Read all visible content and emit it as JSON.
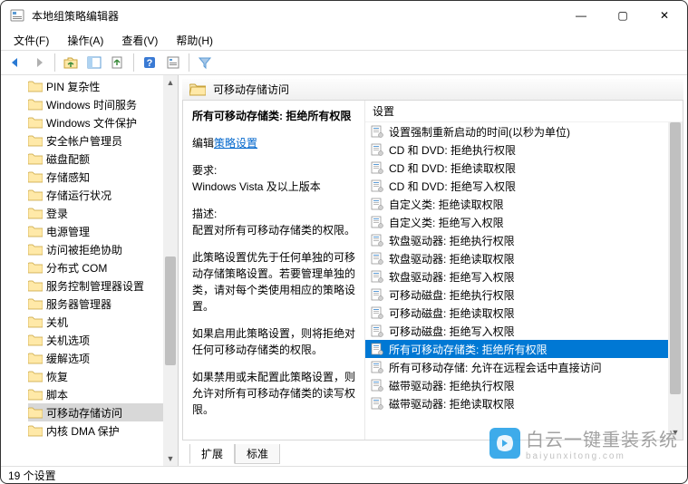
{
  "window": {
    "title": "本地组策略编辑器",
    "min": "—",
    "max": "▢",
    "close": "✕"
  },
  "menu": {
    "file": "文件(F)",
    "action": "操作(A)",
    "view": "查看(V)",
    "help": "帮助(H)"
  },
  "tree": {
    "items": [
      "PIN 复杂性",
      "Windows 时间服务",
      "Windows 文件保护",
      "安全帐户管理员",
      "磁盘配额",
      "存储感知",
      "存储运行状况",
      "登录",
      "电源管理",
      "访问被拒绝协助",
      "分布式 COM",
      "服务控制管理器设置",
      "服务器管理器",
      "关机",
      "关机选项",
      "缓解选项",
      "恢复",
      "脚本",
      "可移动存储访问",
      "内核 DMA 保护"
    ],
    "selected_index": 18
  },
  "detail": {
    "header": "可移动存储访问",
    "selected_title_prefix": "所有可移动存储类: ",
    "selected_title_bold": "拒绝所有权限",
    "edit_prefix": "编辑",
    "edit_link": "策略设置",
    "req_label": "要求:",
    "req_value": "Windows Vista 及以上版本",
    "desc_label": "描述:",
    "desc_value": "配置对所有可移动存储类的权限。",
    "para1": "此策略设置优先于任何单独的可移动存储策略设置。若要管理单独的类，请对每个类使用相应的策略设置。",
    "para2": "如果启用此策略设置，则将拒绝对任何可移动存储类的权限。",
    "para3": "如果禁用或未配置此策略设置，则允许对所有可移动存储类的读写权限。"
  },
  "settings": {
    "header": "设置",
    "items": [
      "设置强制重新启动的时间(以秒为单位)",
      "CD 和 DVD: 拒绝执行权限",
      "CD 和 DVD: 拒绝读取权限",
      "CD 和 DVD: 拒绝写入权限",
      "自定义类: 拒绝读取权限",
      "自定义类: 拒绝写入权限",
      "软盘驱动器: 拒绝执行权限",
      "软盘驱动器: 拒绝读取权限",
      "软盘驱动器: 拒绝写入权限",
      "可移动磁盘: 拒绝执行权限",
      "可移动磁盘: 拒绝读取权限",
      "可移动磁盘: 拒绝写入权限",
      "所有可移动存储类: 拒绝所有权限",
      "所有可移动存储: 允许在远程会话中直接访问",
      "磁带驱动器: 拒绝执行权限",
      "磁带驱动器: 拒绝读取权限"
    ],
    "selected_index": 12
  },
  "tabs": {
    "extended": "扩展",
    "standard": "标准"
  },
  "statusbar": "19 个设置",
  "watermark": {
    "text": "白云一键重装系统",
    "sub": "baiyunxitong.com"
  }
}
